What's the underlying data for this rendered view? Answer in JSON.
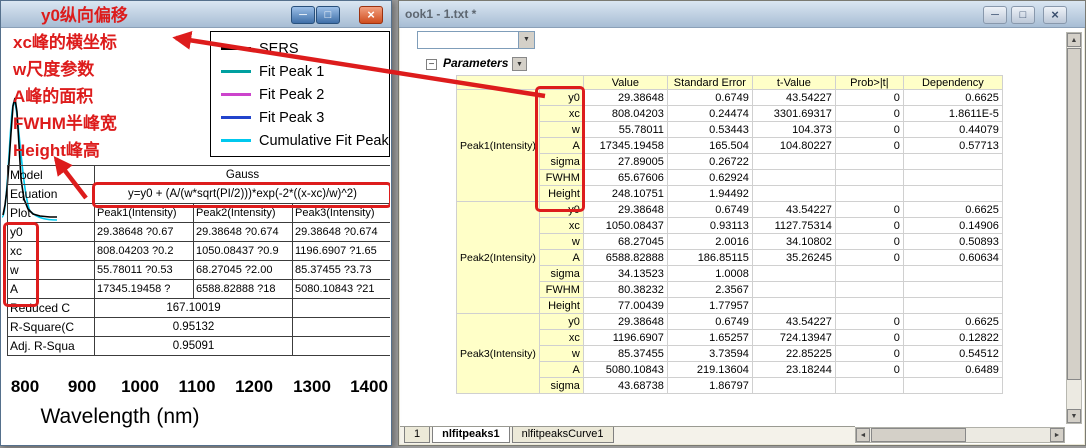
{
  "colors": {
    "accent_red": "#dd1c1c",
    "cream": "#ffffc8",
    "titlebar_top": "#dae6f2",
    "titlebar_bottom": "#a7bdd4",
    "mdi_background": "#9a9a9a"
  },
  "window_controls": {
    "minimize": "─",
    "restore": "□",
    "close": "×"
  },
  "icons": {
    "chevron_down": "▼",
    "triangle_up": "▲",
    "triangle_down": "▼",
    "triangle_left": "◄",
    "triangle_right": "►",
    "collapse": "−"
  },
  "left_window": {
    "annotations": [
      "y0纵向偏移",
      "xc峰的横坐标",
      "w尺度参数",
      "A峰的面积",
      "FWHM半峰宽",
      "Height峰高"
    ],
    "legend": {
      "entries": [
        {
          "label": "SERS",
          "color": "#000000"
        },
        {
          "label": "Fit Peak 1",
          "color": "#00a0a0"
        },
        {
          "label": "Fit Peak 2",
          "color": "#cc44cc"
        },
        {
          "label": "Fit Peak 3",
          "color": "#2244cc"
        },
        {
          "label": "Cumulative Fit Peak",
          "color": "#00c8ee"
        }
      ]
    },
    "results_table": {
      "rows": [
        {
          "label": "Model",
          "type": "merged3",
          "value": "Gauss"
        },
        {
          "label": "Equation",
          "type": "merged3",
          "value": "y=y0 + (A/(w*sqrt(PI/2)))*exp(-2*((x-xc)/w)^2)"
        },
        {
          "label": "Plot",
          "type": "cols",
          "values": [
            "Peak1(Intensity)",
            "Peak2(Intensity)",
            "Peak3(Intensity)"
          ]
        },
        {
          "label": "y0",
          "type": "cols",
          "values": [
            "29.38648 ?0.67",
            "29.38648 ?0.674",
            "29.38648 ?0.674"
          ]
        },
        {
          "label": "xc",
          "type": "cols",
          "values": [
            "808.04203 ?0.2",
            "1050.08437 ?0.9",
            "1196.6907 ?1.65"
          ]
        },
        {
          "label": "w",
          "type": "cols",
          "values": [
            "55.78011 ?0.53",
            "68.27045 ?2.00",
            "85.37455 ?3.73"
          ]
        },
        {
          "label": "A",
          "type": "cols",
          "values": [
            "17345.19458 ?",
            "6588.82888 ?18",
            "5080.10843 ?21"
          ]
        },
        {
          "label": "Reduced C",
          "type": "merged2",
          "value": "167.10019"
        },
        {
          "label": "R-Square(C",
          "type": "merged2",
          "value": "0.95132"
        },
        {
          "label": "Adj. R-Squa",
          "type": "merged2",
          "value": "0.95091"
        }
      ]
    },
    "x_axis": {
      "ticks": [
        "800",
        "900",
        "1000",
        "1100",
        "1200",
        "1300",
        "1400"
      ],
      "label": "Wavelength (nm)"
    }
  },
  "right_window": {
    "title": "ook1 - 1.txt *",
    "parameters_label": "Parameters",
    "param_table": {
      "headers": [
        "Value",
        "Standard Error",
        "t-Value",
        "Prob>|t|",
        "Dependency"
      ],
      "groups": [
        {
          "name": "Peak1(Intensity)",
          "rows": [
            {
              "param": "y0",
              "values": [
                "29.38648",
                "0.6749",
                "43.54227",
                "0",
                "0.6625"
              ]
            },
            {
              "param": "xc",
              "values": [
                "808.04203",
                "0.24474",
                "3301.69317",
                "0",
                "1.8611E-5"
              ]
            },
            {
              "param": "w",
              "values": [
                "55.78011",
                "0.53443",
                "104.373",
                "0",
                "0.44079"
              ]
            },
            {
              "param": "A",
              "values": [
                "17345.19458",
                "165.504",
                "104.80227",
                "0",
                "0.57713"
              ]
            },
            {
              "param": "sigma",
              "values": [
                "27.89005",
                "0.26722",
                "",
                "",
                ""
              ]
            },
            {
              "param": "FWHM",
              "values": [
                "65.67606",
                "0.62924",
                "",
                "",
                ""
              ]
            },
            {
              "param": "Height",
              "values": [
                "248.10751",
                "1.94492",
                "",
                "",
                ""
              ]
            }
          ]
        },
        {
          "name": "Peak2(Intensity)",
          "rows": [
            {
              "param": "y0",
              "values": [
                "29.38648",
                "0.6749",
                "43.54227",
                "0",
                "0.6625"
              ]
            },
            {
              "param": "xc",
              "values": [
                "1050.08437",
                "0.93113",
                "1127.75314",
                "0",
                "0.14906"
              ]
            },
            {
              "param": "w",
              "values": [
                "68.27045",
                "2.0016",
                "34.10802",
                "0",
                "0.50893"
              ]
            },
            {
              "param": "A",
              "values": [
                "6588.82888",
                "186.85115",
                "35.26245",
                "0",
                "0.60634"
              ]
            },
            {
              "param": "sigma",
              "values": [
                "34.13523",
                "1.0008",
                "",
                "",
                ""
              ]
            },
            {
              "param": "FWHM",
              "values": [
                "80.38232",
                "2.3567",
                "",
                "",
                ""
              ]
            },
            {
              "param": "Height",
              "values": [
                "77.00439",
                "1.77957",
                "",
                "",
                ""
              ]
            }
          ]
        },
        {
          "name": "Peak3(Intensity)",
          "rows": [
            {
              "param": "y0",
              "values": [
                "29.38648",
                "0.6749",
                "43.54227",
                "0",
                "0.6625"
              ]
            },
            {
              "param": "xc",
              "values": [
                "1196.6907",
                "1.65257",
                "724.13947",
                "0",
                "0.12822"
              ]
            },
            {
              "param": "w",
              "values": [
                "85.37455",
                "3.73594",
                "22.85225",
                "0",
                "0.54512"
              ]
            },
            {
              "param": "A",
              "values": [
                "5080.10843",
                "219.13604",
                "23.18244",
                "0",
                "0.6489"
              ]
            },
            {
              "param": "sigma",
              "values": [
                "43.68738",
                "1.86797",
                "",
                "",
                ""
              ]
            }
          ]
        }
      ]
    },
    "sheet_tabs": [
      {
        "label": "1",
        "active": false
      },
      {
        "label": "nlfitpeaks1",
        "active": true
      },
      {
        "label": "nlfitpeaksCurve1",
        "active": false
      }
    ]
  }
}
